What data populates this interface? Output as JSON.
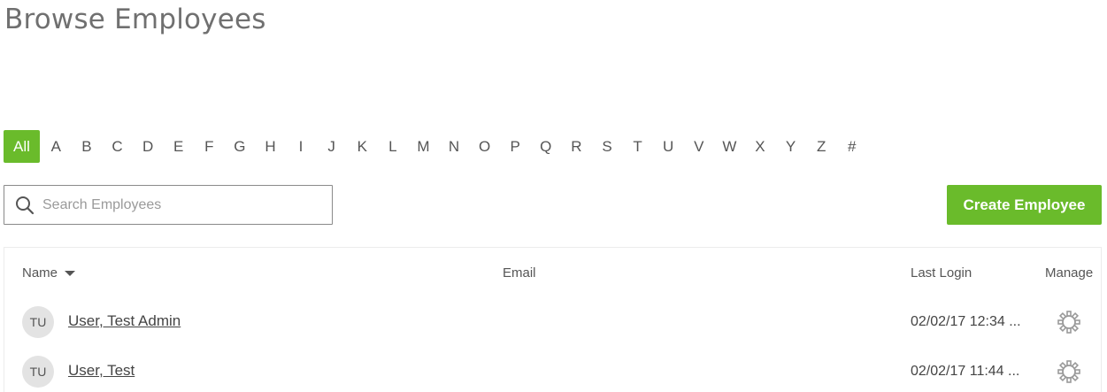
{
  "page": {
    "title": "Browse Employees"
  },
  "alphabet": {
    "active": "All",
    "letters": [
      "All",
      "A",
      "B",
      "C",
      "D",
      "E",
      "F",
      "G",
      "H",
      "I",
      "J",
      "K",
      "L",
      "M",
      "N",
      "O",
      "P",
      "Q",
      "R",
      "S",
      "T",
      "U",
      "V",
      "W",
      "X",
      "Y",
      "Z",
      "#"
    ]
  },
  "search": {
    "placeholder": "Search Employees",
    "value": "",
    "icon": "search-icon"
  },
  "create_button": {
    "label": "Create Employee"
  },
  "table": {
    "headers": {
      "name": "Name",
      "email": "Email",
      "last_login": "Last Login",
      "manage": "Manage"
    },
    "sort": {
      "column": "name",
      "direction": "descending-caret"
    },
    "rows": [
      {
        "initials": "TU",
        "name": "User, Test Admin",
        "email": "",
        "last_login": "02/02/17 12:34 ...",
        "manage_icon": "gear-icon"
      },
      {
        "initials": "TU",
        "name": "User, Test",
        "email": "",
        "last_login": "02/02/17 11:44 ...",
        "manage_icon": "gear-icon"
      }
    ]
  },
  "colors": {
    "accent": "#6abb2b",
    "text": "#444444",
    "title": "#707070",
    "gear": "#9a9a9a"
  }
}
